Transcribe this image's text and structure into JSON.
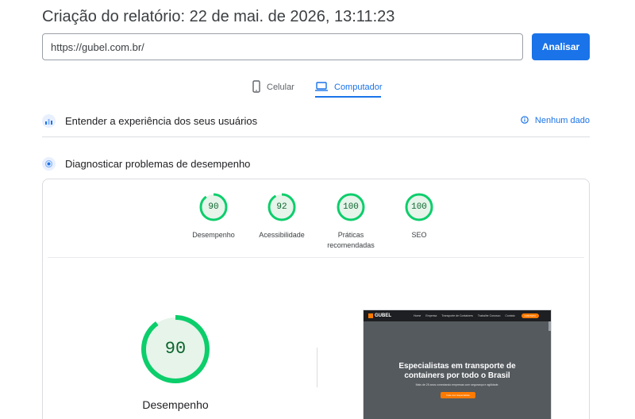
{
  "header": {
    "title": "Criação do relatório: 22 de mai. de 2026, 13:11:23"
  },
  "url_bar": {
    "value": "https://gubel.com.br/",
    "button_label": "Analisar"
  },
  "tabs": [
    {
      "label": "Celular",
      "icon": "phone-icon",
      "active": false
    },
    {
      "label": "Computador",
      "icon": "laptop-icon",
      "active": true
    }
  ],
  "sections": {
    "experience": {
      "label": "Entender a experiência dos seus usuários",
      "status": "Nenhum dado"
    },
    "diagnose": {
      "label": "Diagnosticar problemas de desempenho"
    }
  },
  "scores": [
    {
      "value": "90",
      "fraction": 0.9,
      "label": "Desempenho"
    },
    {
      "value": "92",
      "fraction": 0.92,
      "label": "Acessibilidade"
    },
    {
      "value": "100",
      "fraction": 1.0,
      "label": "Práticas recomendadas"
    },
    {
      "value": "100",
      "fraction": 1.0,
      "label": "SEO"
    }
  ],
  "main_score": {
    "value": "90",
    "fraction": 0.9,
    "label": "Desempenho"
  },
  "colors": {
    "accent": "#1a73e8",
    "pass": "#0cce6b",
    "pass_bg": "#e6f4ea"
  },
  "screenshot": {
    "logo": "GUBEL",
    "menu": [
      "Home",
      "Empresa",
      "Transporte de Containers",
      "Trabalhe Conosco",
      "Contato"
    ],
    "cta": "CONTATO",
    "heading_line1": "Especialistas em transporte de",
    "heading_line2": "containers por todo o Brasil",
    "subtext": "Mais de 25 anos conectando empresas com segurança e agilidade.",
    "button": "Fale com Especialista"
  }
}
